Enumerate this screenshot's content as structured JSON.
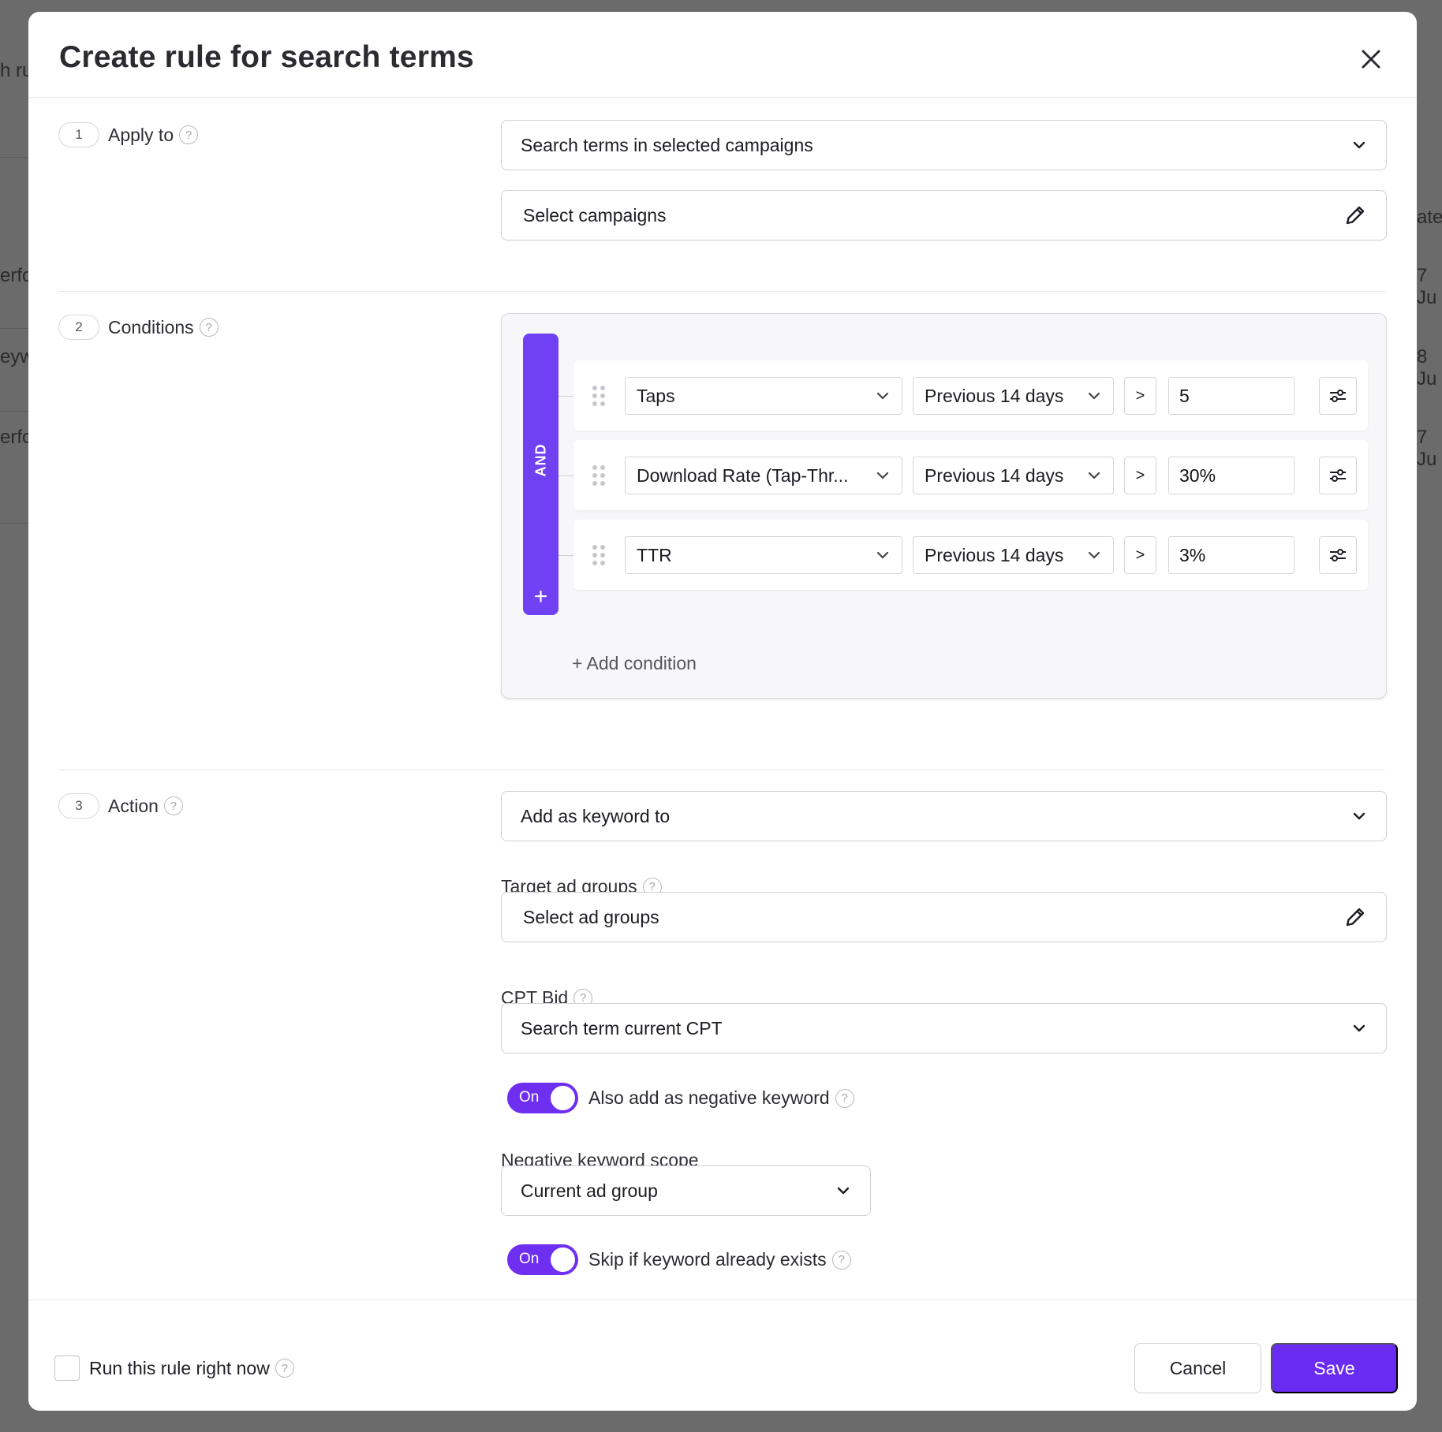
{
  "background": {
    "fragments_left": [
      "h ru",
      "erfo",
      "eyw",
      "erfo"
    ],
    "fragments_right": [
      "ate",
      "7 Ju",
      "8 Ju",
      "7 Ju"
    ]
  },
  "modal": {
    "title": "Create rule for search terms",
    "close_icon": "close-icon"
  },
  "apply_to": {
    "step": "1",
    "label": "Apply to",
    "scope_value": "Search terms in selected campaigns",
    "campaigns_value": "Select campaigns"
  },
  "conditions": {
    "step": "2",
    "label": "Conditions",
    "logic": "AND",
    "add_label": "+ Add condition",
    "rows": [
      {
        "metric": "Taps",
        "period": "Previous 14 days",
        "operator": ">",
        "value": "5"
      },
      {
        "metric": "Download Rate (Tap-Thr...",
        "period": "Previous 14 days",
        "operator": ">",
        "value": "30%"
      },
      {
        "metric": "TTR",
        "period": "Previous 14 days",
        "operator": ">",
        "value": "3%"
      }
    ]
  },
  "action": {
    "step": "3",
    "label": "Action",
    "action_value": "Add as keyword to",
    "target_label": "Target ad groups",
    "target_value": "Select ad groups",
    "bid_label": "CPT Bid",
    "bid_value": "Search term current CPT",
    "negative_toggle": {
      "state": "On",
      "label": "Also add as negative keyword"
    },
    "neg_scope_label": "Negative keyword scope",
    "neg_scope_value": "Current ad group",
    "skip_toggle": {
      "state": "On",
      "label": "Skip if keyword already exists"
    }
  },
  "footer": {
    "run_now_label": "Run this rule right now",
    "cancel_label": "Cancel",
    "save_label": "Save"
  },
  "colors": {
    "accent": "#6a2cf3",
    "and_bar": "#7040f3"
  }
}
